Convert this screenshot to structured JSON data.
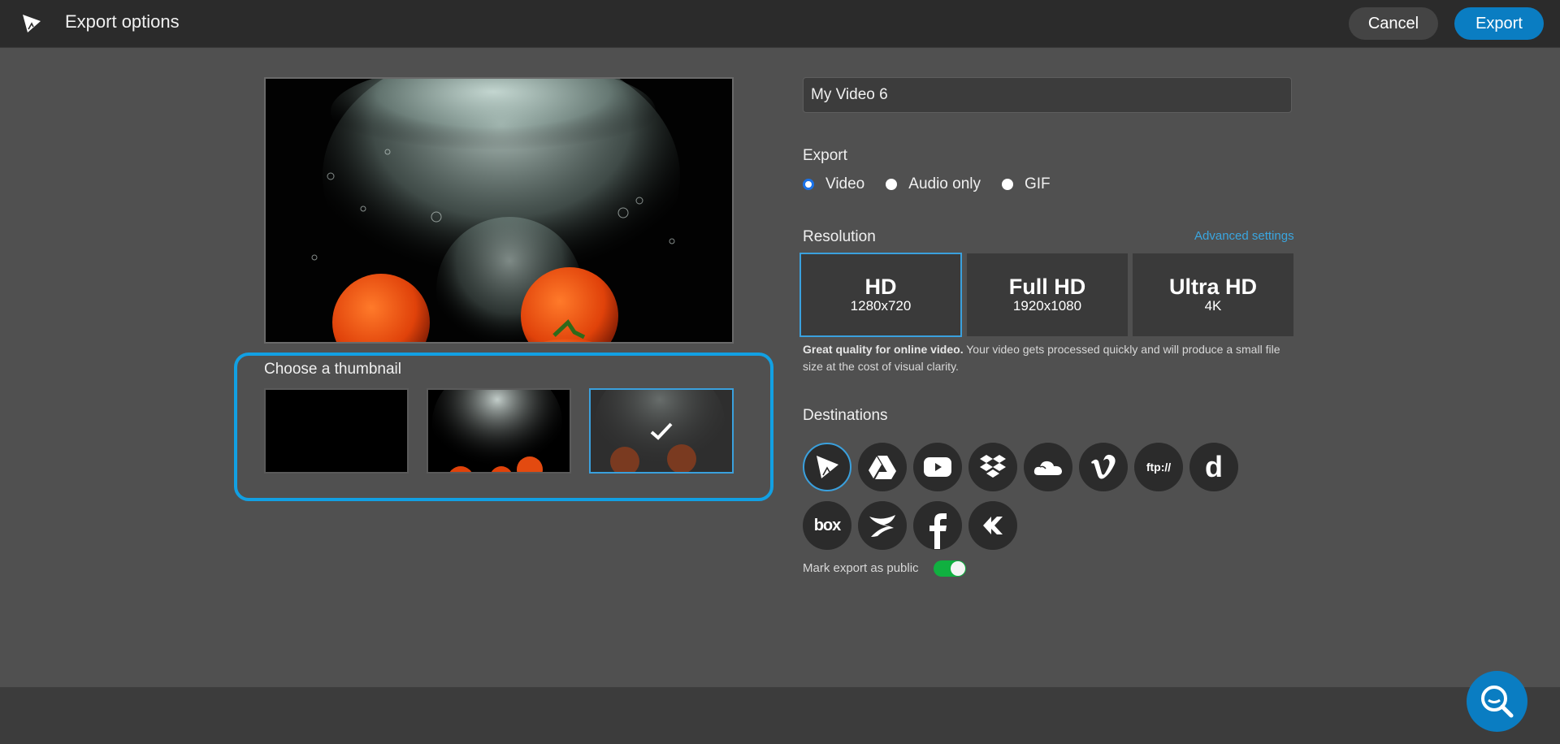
{
  "header": {
    "logo_icon": "app-logo-icon",
    "title": "Export options",
    "cancel_label": "Cancel",
    "export_label": "Export"
  },
  "preview": {
    "description": "Tomatoes splashing into water with bubbles"
  },
  "thumbnails": {
    "title": "Choose a thumbnail",
    "items": [
      {
        "description": "black frame",
        "selected": false
      },
      {
        "description": "bubbles and tomatoes",
        "selected": false
      },
      {
        "description": "dimmed bubbles and tomatoes",
        "selected": true
      }
    ]
  },
  "video_name": {
    "value": "My Video 6"
  },
  "export": {
    "label": "Export",
    "options": [
      {
        "label": "Video",
        "selected": true
      },
      {
        "label": "Audio only",
        "selected": false
      },
      {
        "label": "GIF",
        "selected": false
      }
    ]
  },
  "resolution": {
    "label": "Resolution",
    "advanced_link": "Advanced settings",
    "options": [
      {
        "name": "HD",
        "detail": "1280x720",
        "selected": true
      },
      {
        "name": "Full HD",
        "detail": "1920x1080",
        "selected": false
      },
      {
        "name": "Ultra HD",
        "detail": "4K",
        "selected": false
      }
    ],
    "description_bold": "Great quality for online video.",
    "description_rest": " Your video gets processed quickly and will produce a small file size at the cost of visual clarity."
  },
  "destinations": {
    "label": "Destinations",
    "items": [
      {
        "name": "WeVideo",
        "icon": "wevideo-icon",
        "selected": true
      },
      {
        "name": "Google Drive",
        "icon": "google-drive-icon",
        "selected": false
      },
      {
        "name": "YouTube",
        "icon": "youtube-icon",
        "selected": false
      },
      {
        "name": "Dropbox",
        "icon": "dropbox-icon",
        "selected": false
      },
      {
        "name": "OneDrive",
        "icon": "onedrive-icon",
        "selected": false
      },
      {
        "name": "Vimeo",
        "icon": "vimeo-icon",
        "selected": false
      },
      {
        "name": "FTP",
        "icon": "ftp-icon",
        "text": "ftp://",
        "selected": false
      },
      {
        "name": "Dailymotion",
        "icon": "dailymotion-icon",
        "text": "d",
        "selected": false
      },
      {
        "name": "Box",
        "icon": "box-icon",
        "text": "box",
        "selected": false
      },
      {
        "name": "Screencast",
        "icon": "screencast-icon",
        "selected": false
      },
      {
        "name": "Facebook",
        "icon": "facebook-icon",
        "text": "f",
        "selected": false
      },
      {
        "name": "Rewind",
        "icon": "rewind-icon",
        "selected": false
      }
    ],
    "public_label": "Mark export as public",
    "public_enabled": true
  },
  "help": {
    "icon": "search-help-icon"
  },
  "colors": {
    "accent": "#0a7dc2",
    "highlight": "#12a0e3",
    "toggle_on": "#10b040",
    "topbar": "#2b2b2b",
    "background": "#505050"
  }
}
